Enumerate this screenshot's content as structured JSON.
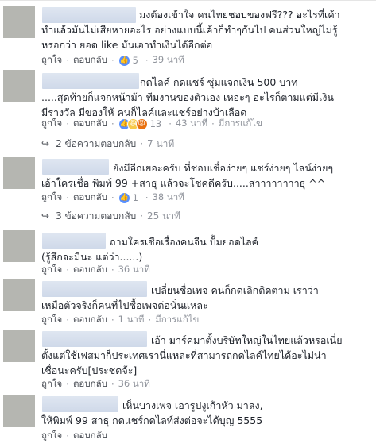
{
  "ui": {
    "like_label": "ถูกใจ",
    "reply_label": "ตอบกลับ",
    "sep": "·",
    "edited_label": "มีการแก้ไข"
  },
  "comments": [
    {
      "lines": [
        "มงต้องเข้าใจ คนไทยชอบของฟรี??? อะไรที่เค้า",
        "ทำแล้วมันไม่เสียหายอะไร อย่างแบบนี้เค้าก็ทำๆกันไป คนส่วนใหญ่ไม่รู้",
        "หรอกว่า ยอด like มันเอาทำเงินได้อีกต่อ"
      ],
      "reaction_count": "5",
      "time": "39 นาที"
    },
    {
      "lines": [
        "กดไลค์ กดแชร์ ซุ่มแจกเงิน 500 บาท",
        ".....สุดท้ายก็แจกหน้าม้า ทีมงานของตัวเอง เหอะๆ อะไรก็ตามแต่มีเงิน",
        "มีรางวัล มีของให้ คนก็ไลค์และแชร์อย่างบ้าเลือด"
      ],
      "reaction_count": "13",
      "time": "43 นาที",
      "replies_label": "2 ข้อความตอบกลับ",
      "replies_time": "7 นาที"
    },
    {
      "lines": [
        "ยังมีอีกเยอะครับ ที่ชอบเชื่อง่ายๆ แชร์ง่ายๆ ไลน์ง่ายๆ",
        "เอ้าใครเชื่อ พิมพ์ 99 +สาธุ แล้วจะโชคดีครับ.....สาาาาาาาาธุ ^^"
      ],
      "reaction_count": "1",
      "time": "38 นาที",
      "replies_label": "3 ข้อความตอบกลับ",
      "replies_time": "25 นาที"
    },
    {
      "lines": [
        "ถามใครเชื่อเรื่องคนจีน ปั้มยอดไลค์",
        "(รู้สึกจะมีนะ แต่ว่า......)"
      ],
      "time": "36 นาที"
    },
    {
      "lines": [
        "เปลี่ยนชื่อเพจ คนก็กดเลิกติดตาม เราว่า",
        "เหมือตัวจริงก็คนที่ไปซื้อเพจต่อนั่นแหละ"
      ],
      "time": "1 นาที"
    },
    {
      "lines": [
        "เอ้า มาร์คมาตั้งบริษัทใหญ่ในไทยแล้วหรอเนี่ย",
        "ตั้งแต่ใช้เฟสมาก็ประเทศเรานี่แหละที่สามารถกดไลค์ไทยได้อะไม่น่า",
        "เชื่อนะครับ[ประชดจ้ะ]"
      ],
      "time": "36 นาที"
    },
    {
      "lines": [
        "เห็นบางเพจ เอารูปงูเก้าหัว มาลง,",
        "ให้พิมพ์ 99 สาธุ กดแชร์กดไลท์ส่งต่อจะได้บุญ 5555"
      ]
    }
  ]
}
